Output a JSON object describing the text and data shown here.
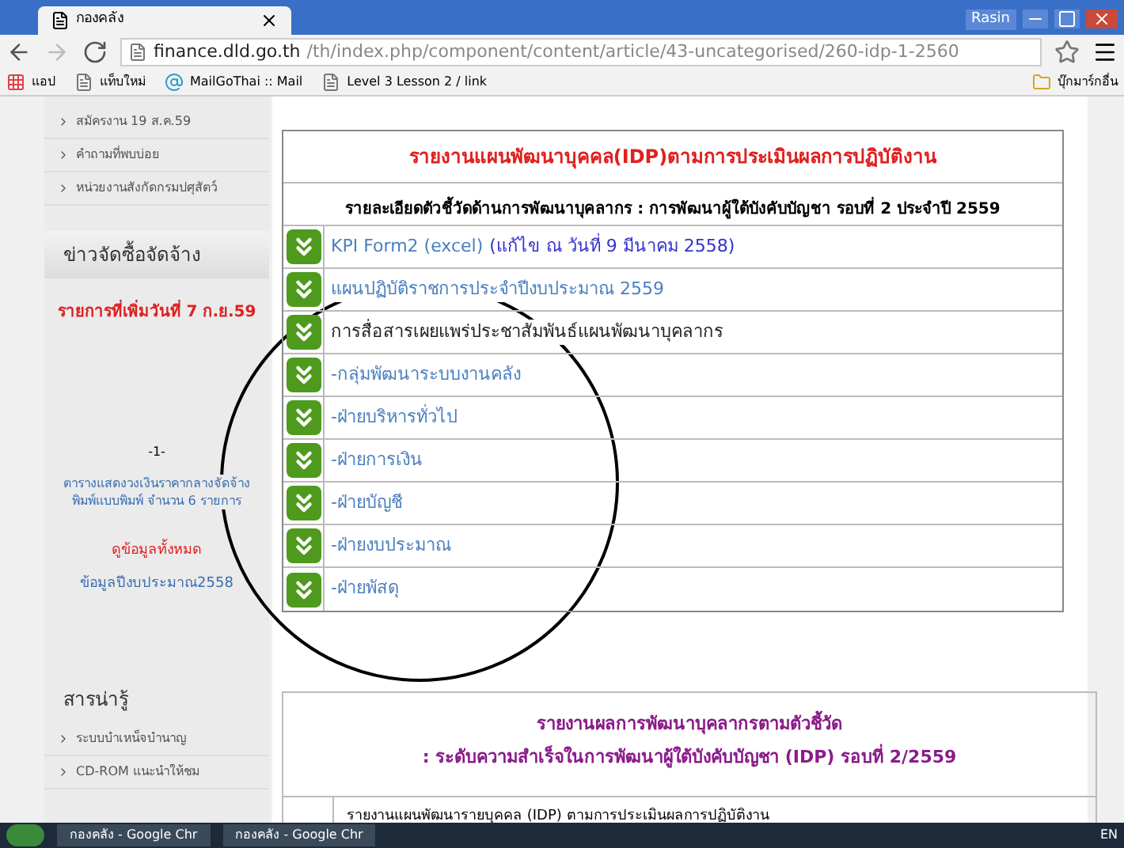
{
  "browser": {
    "tab_title": "กองคลัง",
    "user": "Rasin",
    "url_host": "finance.dld.go.th",
    "url_path": "/th/index.php/component/content/article/43-uncategorised/260-idp-1-2560",
    "bookmarks": [
      "แอป",
      "แท็บใหม่",
      "MailGoThai :: Mail",
      "Level 3 Lesson 2 / link"
    ],
    "other_bookmarks": "บุ๊กมาร์กอื่น"
  },
  "sidebar": {
    "top_links": [
      "สมัครงาน 19 ส.ค.59",
      "คำถามที่พบบ่อย",
      "หน่วยงานสังกัดกรมปศุสัตว์"
    ],
    "procurement": {
      "heading": "ข่าวจัดซื้อจัดจ้าง",
      "notice": "รายการที่เพิ่มวันที่ 7 ก.ย.59",
      "page": "-1-",
      "entry": "ตารางแสดงวงเงินราคากลางจัดจ้างพิมพ์แบบพิมพ์ จำนวน 6 รายการ",
      "view_all": "ดูข้อมูลทั้งหมด",
      "archive": "ข้อมูลปีงบประมาณ2558"
    },
    "knowledge": {
      "heading": "สารน่ารู้",
      "links": [
        "ระบบบำเหน็จบำนาญ",
        "CD-ROM แนะนำให้ชม"
      ]
    }
  },
  "idp_table": {
    "title": "รายงานแผนพัฒนาบุคคล(IDP)ตามการประเมินผลการปฏิบัติงาน",
    "subtitle": "รายละเอียดตัวชี้วัดด้านการพัฒนาบุคลากร : การพัฒนาผู้ใต้บังคับบัญชา รอบที่ 2 ประจำปี 2559",
    "rows": [
      {
        "label": "KPI Form2 (excel)",
        "note": "(แก้ไข ณ วันที่ 9 มีนาคม 2558)",
        "kind": "link"
      },
      {
        "label": "แผนปฏิบัติราชการประจำปีงบประมาณ 2559",
        "kind": "link"
      },
      {
        "label": "การสื่อสารเผยแพร่ประชาสัมพันธ์แผนพัฒนาบุคลากร",
        "kind": "plain"
      },
      {
        "label": "-กลุ่มพัฒนาระบบงานคลัง",
        "kind": "link"
      },
      {
        "label": "-ฝ่ายบริหารทั่วไป",
        "kind": "link"
      },
      {
        "label": "-ฝ่ายการเงิน",
        "kind": "link"
      },
      {
        "label": "-ฝ่ายบัญชี",
        "kind": "link"
      },
      {
        "label": "-ฝ่ายงบประมาณ",
        "kind": "link"
      },
      {
        "label": "-ฝ่ายพัสดุ",
        "kind": "link"
      }
    ]
  },
  "results_table": {
    "title_line_1": "รายงานผลการพัฒนาบุคลากรตามตัวชี้วัด",
    "title_line_2": ": ระดับความสำเร็จในการพัฒนาผู้ใต้บังคับบัญชา (IDP) รอบที่ 2/2559",
    "first_row": "รายงานแผนพัฒนารายบุคคล (IDP) ตามการประเมินผลการปฏิบัติงาน"
  },
  "taskbar": {
    "windows": [
      "กองคลัง - Google Chr",
      "กองคลัง - Google Chr"
    ],
    "language": "EN"
  }
}
